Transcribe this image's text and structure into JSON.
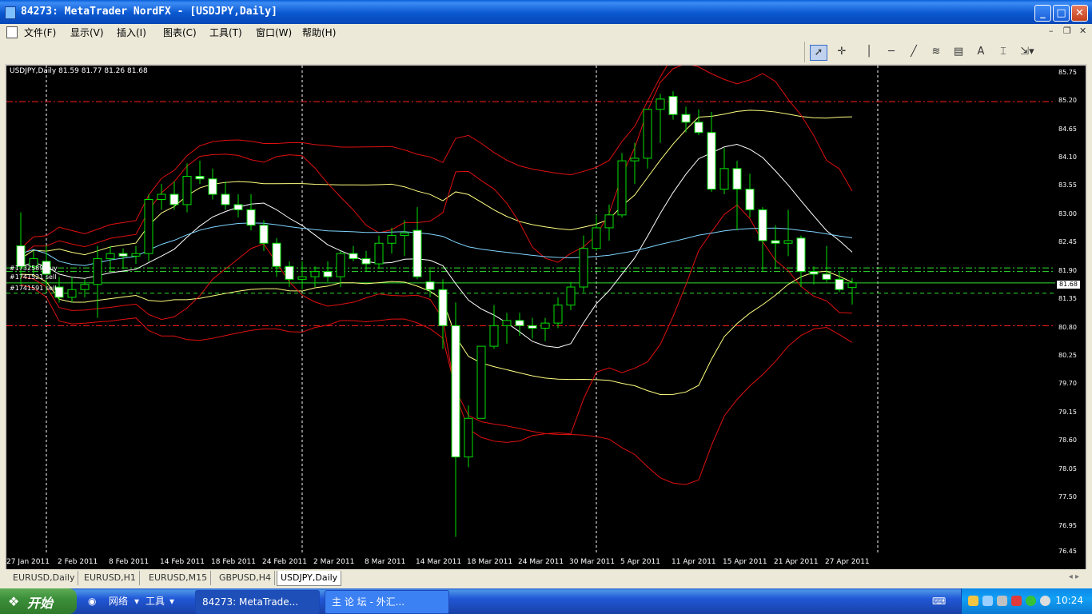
{
  "window": {
    "title": "84273: MetaTrader NordFX - [USDJPY,Daily]",
    "minimize": "_",
    "maximize": "□",
    "close": "✕"
  },
  "menu": {
    "items": [
      "文件(F)",
      "显示(V)",
      "插入(I)",
      "图表(C)",
      "工具(T)",
      "窗口(W)",
      "帮助(H)"
    ],
    "mdi_min": "–",
    "mdi_restore": "❐",
    "mdi_close": "✕"
  },
  "toolbar": {
    "tools": [
      "cursor-icon",
      "crosshair-icon",
      "vertical-line-icon",
      "horizontal-line-icon",
      "trendline-icon",
      "fibonacci-icon",
      "channel-icon",
      "text-icon",
      "text-label-icon",
      "arrows-icon"
    ],
    "text_tool_label": "A"
  },
  "chart": {
    "info": "USDJPY,Daily  81.59 81.77 81.26 81.68",
    "current_price": "81.68",
    "orders": [
      "#1732589 buy",
      "#1741521 sell",
      "#1741591 sell"
    ],
    "colors": {
      "bull": "#000000",
      "bear": "#ffffff",
      "wick": "#00ff00",
      "upper_bb": "#ff0000",
      "mid": "#ffff66",
      "ma_white": "#ffffff",
      "ma_cyan": "#66ccff",
      "level_red": "#ff0000",
      "level_green": "#00ff00"
    }
  },
  "chart_data": {
    "type": "candlestick",
    "symbol": "USDJPY",
    "timeframe": "Daily",
    "price_ticks": [
      "85.75",
      "85.20",
      "84.65",
      "84.10",
      "83.55",
      "83.00",
      "82.45",
      "81.90",
      "81.35",
      "80.80",
      "80.25",
      "79.70",
      "79.15",
      "78.60",
      "78.05",
      "77.50",
      "76.95",
      "76.45"
    ],
    "time_ticks": [
      "27 Jan 2011",
      "2 Feb 2011",
      "8 Feb 2011",
      "14 Feb 2011",
      "18 Feb 2011",
      "24 Feb 2011",
      "2 Mar 2011",
      "8 Mar 2011",
      "14 Mar 2011",
      "18 Mar 2011",
      "24 Mar 2011",
      "30 Mar 2011",
      "5 Apr 2011",
      "11 Apr 2011",
      "15 Apr 2011",
      "21 Apr 2011",
      "27 Apr 2011"
    ],
    "ylim": [
      76.4,
      85.9
    ],
    "horizontal_levels": [
      {
        "price": 85.2,
        "color": "red",
        "style": "dash-dot"
      },
      {
        "price": 80.85,
        "color": "red",
        "style": "dash-dot"
      },
      {
        "price": 81.97,
        "color": "green",
        "style": "dash-dot"
      },
      {
        "price": 81.9,
        "color": "green",
        "style": "dash-dot"
      },
      {
        "price": 81.68,
        "color": "green",
        "style": "solid"
      },
      {
        "price": 81.48,
        "color": "green",
        "style": "dash"
      }
    ],
    "candles": [
      [
        82.4,
        83.05,
        81.65,
        82.0
      ],
      [
        82.0,
        82.3,
        81.85,
        82.15
      ],
      [
        82.1,
        82.4,
        81.5,
        81.85
      ],
      [
        81.6,
        81.8,
        81.3,
        81.4
      ],
      [
        81.4,
        81.8,
        81.3,
        81.55
      ],
      [
        81.55,
        81.75,
        81.4,
        81.65
      ],
      [
        81.65,
        82.4,
        81.0,
        82.15
      ],
      [
        82.15,
        82.4,
        81.9,
        82.25
      ],
      [
        82.25,
        82.35,
        81.95,
        82.2
      ],
      [
        82.2,
        82.4,
        82.05,
        82.25
      ],
      [
        82.25,
        83.4,
        82.1,
        83.3
      ],
      [
        83.3,
        83.6,
        83.1,
        83.4
      ],
      [
        83.4,
        83.65,
        83.1,
        83.2
      ],
      [
        83.2,
        84.0,
        83.05,
        83.75
      ],
      [
        83.75,
        84.05,
        83.6,
        83.7
      ],
      [
        83.7,
        83.9,
        83.3,
        83.4
      ],
      [
        83.4,
        83.65,
        83.1,
        83.2
      ],
      [
        83.2,
        83.4,
        82.95,
        83.1
      ],
      [
        83.1,
        83.4,
        82.7,
        82.8
      ],
      [
        82.8,
        82.9,
        82.3,
        82.45
      ],
      [
        82.45,
        82.55,
        81.8,
        82.0
      ],
      [
        82.0,
        82.1,
        81.6,
        81.75
      ],
      [
        81.75,
        82.1,
        81.55,
        81.8
      ],
      [
        81.8,
        82.0,
        81.6,
        81.9
      ],
      [
        81.9,
        82.1,
        81.7,
        81.8
      ],
      [
        81.8,
        82.3,
        81.6,
        82.25
      ],
      [
        82.25,
        82.4,
        82.1,
        82.15
      ],
      [
        82.15,
        82.3,
        81.9,
        82.05
      ],
      [
        82.05,
        82.6,
        81.95,
        82.45
      ],
      [
        82.45,
        82.75,
        82.25,
        82.6
      ],
      [
        82.6,
        82.9,
        82.2,
        82.65
      ],
      [
        82.7,
        83.15,
        81.75,
        81.8
      ],
      [
        81.7,
        81.95,
        81.4,
        81.55
      ],
      [
        81.55,
        81.75,
        80.4,
        80.85
      ],
      [
        80.85,
        81.3,
        76.75,
        78.3
      ],
      [
        78.3,
        79.3,
        78.1,
        79.05
      ],
      [
        79.05,
        80.4,
        79.1,
        80.45
      ],
      [
        80.45,
        81.25,
        80.4,
        80.85
      ],
      [
        80.85,
        81.1,
        80.5,
        80.95
      ],
      [
        80.95,
        81.1,
        80.65,
        80.85
      ],
      [
        80.85,
        81.0,
        80.6,
        80.8
      ],
      [
        80.8,
        81.0,
        80.55,
        80.9
      ],
      [
        80.9,
        81.4,
        80.8,
        81.25
      ],
      [
        81.25,
        81.7,
        81.15,
        81.6
      ],
      [
        81.6,
        82.6,
        81.5,
        82.35
      ],
      [
        82.35,
        83.0,
        82.3,
        82.75
      ],
      [
        82.75,
        83.2,
        82.5,
        83.0
      ],
      [
        83.0,
        84.2,
        82.95,
        84.05
      ],
      [
        84.05,
        84.4,
        83.6,
        84.1
      ],
      [
        84.1,
        84.9,
        83.9,
        85.05
      ],
      [
        85.05,
        85.35,
        84.4,
        85.25
      ],
      [
        85.3,
        85.4,
        84.85,
        84.95
      ],
      [
        84.95,
        85.1,
        84.6,
        84.8
      ],
      [
        84.8,
        85.05,
        84.55,
        84.6
      ],
      [
        84.6,
        85.0,
        83.45,
        83.5
      ],
      [
        83.5,
        84.3,
        83.4,
        83.9
      ],
      [
        83.9,
        84.05,
        82.7,
        83.5
      ],
      [
        83.5,
        83.8,
        82.95,
        83.1
      ],
      [
        83.1,
        83.15,
        81.9,
        82.5
      ],
      [
        82.5,
        82.8,
        81.95,
        82.45
      ],
      [
        82.45,
        83.1,
        82.2,
        82.5
      ],
      [
        82.55,
        82.6,
        81.6,
        81.9
      ],
      [
        81.9,
        82.0,
        81.65,
        81.85
      ],
      [
        81.85,
        82.4,
        81.7,
        81.75
      ],
      [
        81.75,
        81.9,
        81.5,
        81.55
      ],
      [
        81.59,
        81.77,
        81.26,
        81.68
      ]
    ]
  },
  "tabs": {
    "items": [
      "EURUSD,Daily",
      "EURUSD,H1",
      "EURUSD,M15",
      "GBPUSD,H4",
      "USDJPY,Daily"
    ],
    "active": 4
  },
  "taskbar": {
    "start_label": "开始",
    "quick_items": [
      "网络",
      "工具"
    ],
    "tasks": [
      "84273: MetaTrade...",
      "主 论 坛 - 外汇..."
    ],
    "clock": "10:24"
  }
}
